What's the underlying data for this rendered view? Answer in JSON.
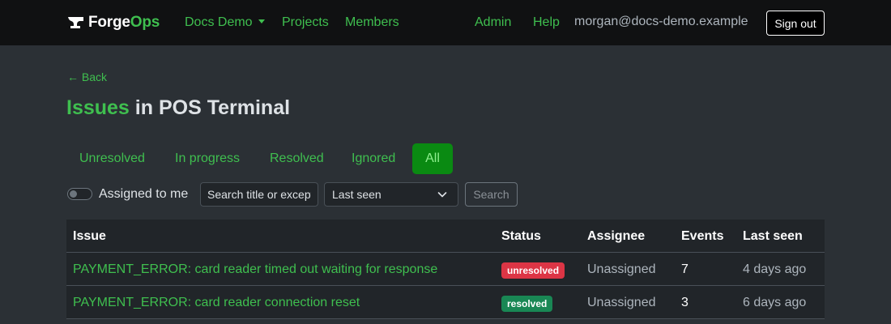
{
  "nav": {
    "brand_forge": "Forge",
    "brand_ops": "Ops",
    "org_label": "Docs Demo",
    "projects": "Projects",
    "members": "Members",
    "admin": "Admin",
    "help": "Help",
    "user_email": "morgan@docs-demo.example",
    "sign_out": "Sign out"
  },
  "header": {
    "back": "← Back",
    "title_link": "Issues",
    "title_rest": " in POS Terminal"
  },
  "tabs": [
    {
      "label": "Unresolved",
      "active": false
    },
    {
      "label": "In progress",
      "active": false
    },
    {
      "label": "Resolved",
      "active": false
    },
    {
      "label": "Ignored",
      "active": false
    },
    {
      "label": "All",
      "active": true
    }
  ],
  "filters": {
    "assigned_label": "Assigned to me",
    "assigned_on": false,
    "search_placeholder": "Search title or exception",
    "sort_value": "Last seen",
    "search_button": "Search"
  },
  "table": {
    "headers": [
      "Issue",
      "Status",
      "Assignee",
      "Events",
      "Last seen"
    ],
    "rows": [
      {
        "title": "PAYMENT_ERROR: card reader timed out waiting for response",
        "status": "unresolved",
        "assignee": "Unassigned",
        "events": "7",
        "last_seen": "4 days ago"
      },
      {
        "title": "PAYMENT_ERROR: card reader connection reset",
        "status": "resolved",
        "assignee": "Unassigned",
        "events": "3",
        "last_seen": "6 days ago"
      }
    ]
  },
  "colors": {
    "accent": "#3fbf4f",
    "badge_unresolved": "#dc3545",
    "badge_resolved": "#198754"
  }
}
